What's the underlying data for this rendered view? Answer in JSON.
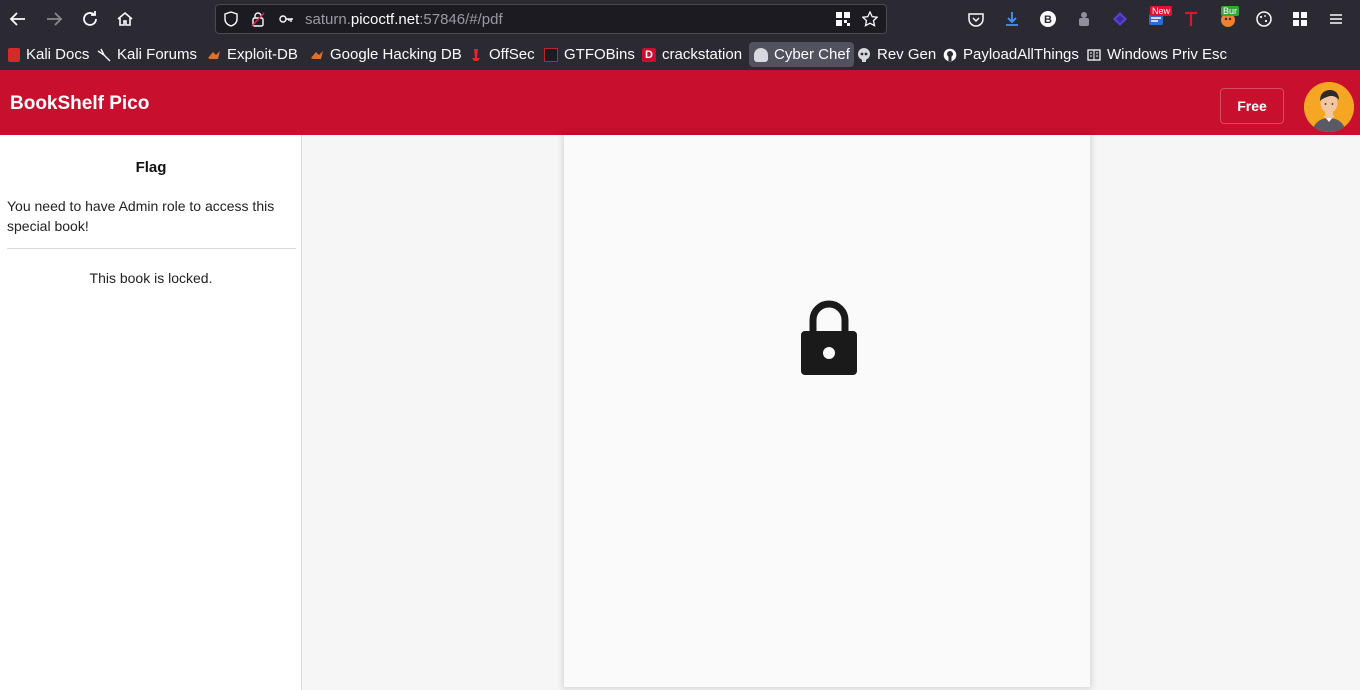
{
  "browser": {
    "url": {
      "prefix": "saturn.",
      "host": "picoctf.net",
      "suffix": ":57846/#/pdf"
    },
    "extension_badges": {
      "new": "New",
      "burp": "Bur"
    },
    "bookmarks": [
      {
        "label": "Kali Docs",
        "icon": "kali-docs-icon"
      },
      {
        "label": "Kali Forums",
        "icon": "kali-forums-icon"
      },
      {
        "label": "Exploit-DB",
        "icon": "exploit-db-icon"
      },
      {
        "label": "Google Hacking DB",
        "icon": "ghdb-icon"
      },
      {
        "label": "OffSec",
        "icon": "offsec-icon"
      },
      {
        "label": "GTFOBins",
        "icon": "gtfobins-icon"
      },
      {
        "label": "crackstation",
        "icon": "crackstation-icon"
      },
      {
        "label": "Cyber Chef",
        "icon": "cyberchef-icon"
      },
      {
        "label": "Rev Gen",
        "icon": "revgen-icon"
      },
      {
        "label": "PayloadAllThings",
        "icon": "github-icon"
      },
      {
        "label": "Windows Priv Esc",
        "icon": "book-icon"
      }
    ]
  },
  "app": {
    "brand": "BookShelf Pico",
    "plan_label": "Free",
    "accent_color": "#c8102e"
  },
  "sidebar": {
    "title": "Flag",
    "description": "You need to have Admin role to access this special book!",
    "status": "This book is locked."
  },
  "viewer": {
    "icon": "lock-icon"
  }
}
